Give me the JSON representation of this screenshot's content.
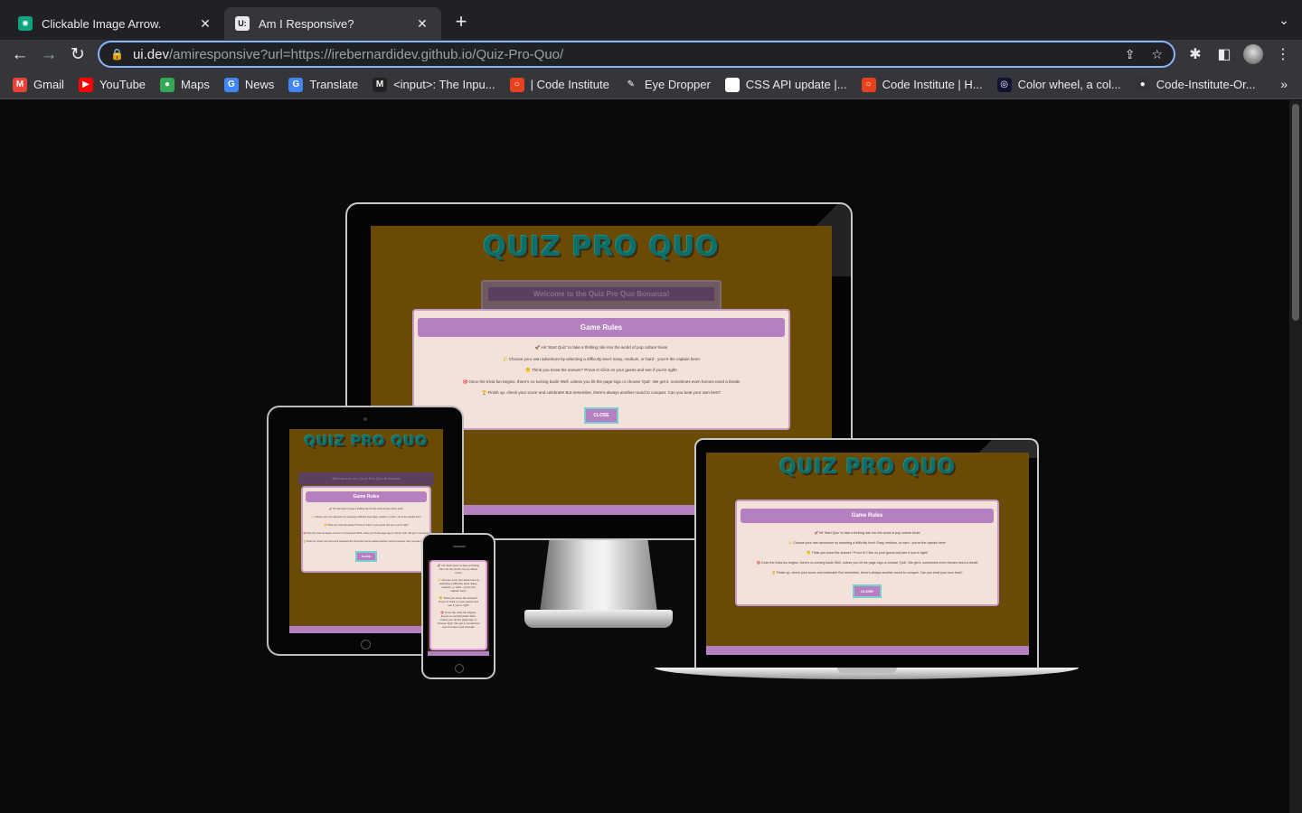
{
  "browser": {
    "tabs": [
      {
        "title": "Clickable Image Arrow.",
        "favicon": "chatgpt-icon",
        "active": false
      },
      {
        "title": "Am I Responsive?",
        "favicon": "U:",
        "active": true
      }
    ],
    "url_host": "ui.dev",
    "url_rest": "/amiresponsive?url=https://irebernardidev.github.io/Quiz-Pro-Quo/"
  },
  "bookmarks": [
    {
      "label": "Gmail",
      "icon": "M",
      "color": "#ea4335"
    },
    {
      "label": "YouTube",
      "icon": "▶",
      "color": "#ff0000"
    },
    {
      "label": "Maps",
      "icon": "●",
      "color": "#34a853"
    },
    {
      "label": "News",
      "icon": "G",
      "color": "#4285f4"
    },
    {
      "label": "Translate",
      "icon": "G",
      "color": "#4285f4"
    },
    {
      "label": "<input>: The Inpu...",
      "icon": "M",
      "color": "#222222"
    },
    {
      "label": "| Code Institute",
      "icon": "○",
      "color": "#e8411d"
    },
    {
      "label": "Eye Dropper",
      "icon": "✎",
      "color": "#35363a"
    },
    {
      "label": "CSS API update  |...",
      "icon": "◆",
      "color": "#ffffff"
    },
    {
      "label": "Code Institute | H...",
      "icon": "○",
      "color": "#e8411d"
    },
    {
      "label": "Color wheel, a col...",
      "icon": "◎",
      "color": "#111133"
    },
    {
      "label": "Code-Institute-Or...",
      "icon": "●",
      "color": "#333333"
    }
  ],
  "site": {
    "brand": "QUIZ PRO QUO",
    "welcome": "Welcome to the Quiz Pro Quo Bonanza!",
    "modal_title": "Game Rules",
    "rules": [
      "🚀 Hit 'Start Quiz' to take a thrilling ride into the world of pop culture trivia!",
      "🧭 Choose your own adventure by selecting a difficulty level: Easy, medium, or hard - you're the captain here!",
      "🤔 Think you know the answer? Prove it! Click on your guess and see if you're right!",
      "🎯 Once the trivia fun begins, there's no turning back! Well, unless you hit the page logo or choose 'Quit'. We get it, sometimes even heroes need a break!",
      "🏆 Finish up, check your score and celebrate! But remember, there's always another round to conquer. Can you beat your own best?"
    ],
    "close_label": "CLOSE"
  }
}
